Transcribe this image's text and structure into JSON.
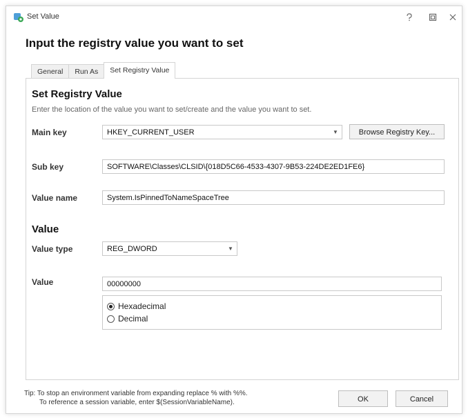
{
  "window": {
    "title": "Set Value",
    "heading": "Input the registry value you want to set"
  },
  "tabs": [
    {
      "label": "General"
    },
    {
      "label": "Run As"
    },
    {
      "label": "Set Registry Value"
    }
  ],
  "registry": {
    "section_title": "Set Registry Value",
    "description": "Enter the location of the value you want to set/create and the value you want to set.",
    "main_key_label": "Main key",
    "main_key_value": "HKEY_CURRENT_USER",
    "browse_button": "Browse Registry Key...",
    "sub_key_label": "Sub key",
    "sub_key_value": "SOFTWARE\\Classes\\CLSID\\{018D5C66-4533-4307-9B53-224DE2ED1FE6}",
    "value_name_label": "Value name",
    "value_name_value": "System.IsPinnedToNameSpaceTree"
  },
  "value_section": {
    "title": "Value",
    "type_label": "Value type",
    "type_value": "REG_DWORD",
    "value_label": "Value",
    "value_value": "00000000",
    "radio_hex": "Hexadecimal",
    "radio_dec": "Decimal",
    "selected": "Hexadecimal"
  },
  "footer": {
    "tip_line1": "Tip: To stop an environment variable from expanding replace % with %%.",
    "tip_line2": "To reference a session variable, enter $(SessionVariableName).",
    "ok": "OK",
    "cancel": "Cancel"
  },
  "icons": {
    "app": "registry-gear-icon",
    "help": "help-icon",
    "maximize": "maximize-icon",
    "close": "close-icon"
  },
  "colors": {
    "accent": "#2e8bd0",
    "border": "#c8c8c8"
  }
}
